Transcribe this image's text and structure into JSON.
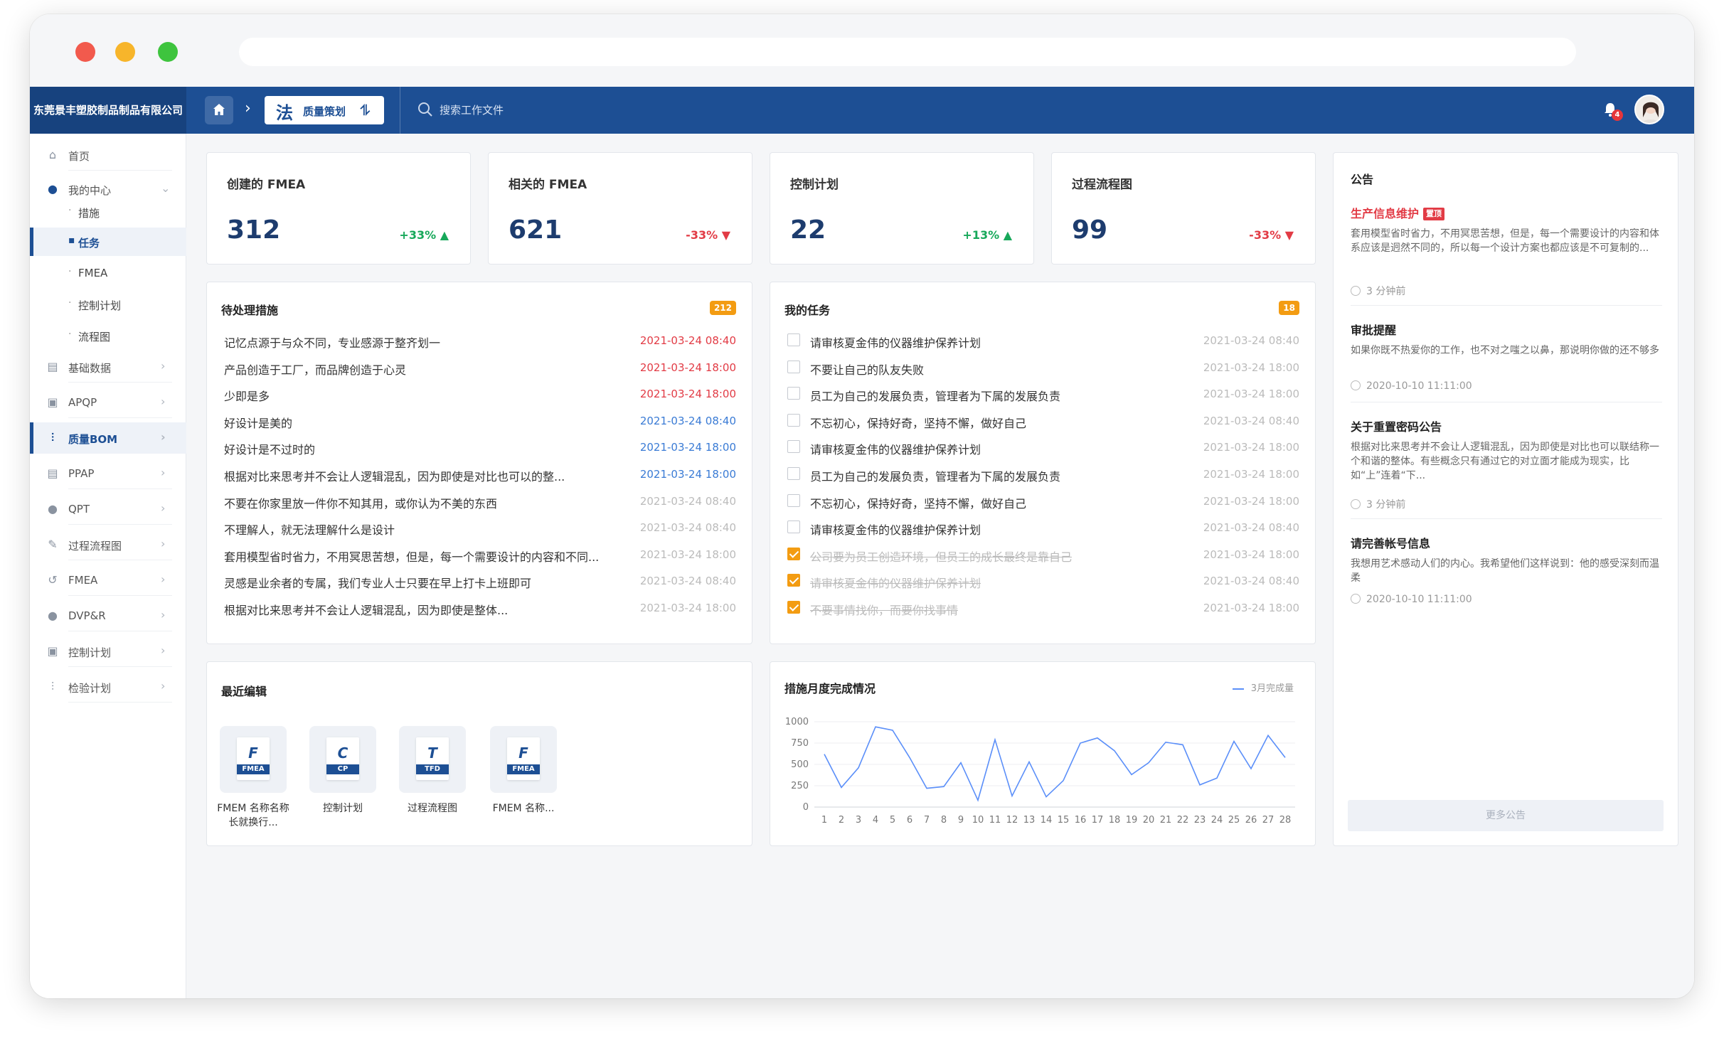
{
  "company": "东莞景丰塑胶制品制品有限公司",
  "breadcrumb": {
    "module_icon_text": "法",
    "module_label": "质量策划",
    "switch_glyph": "⥮"
  },
  "search": {
    "placeholder": "搜索工作文件"
  },
  "notifications": {
    "count": "4"
  },
  "sidebar": {
    "home": "首页",
    "my_center": "我的中心",
    "sub_items": [
      "措施",
      "任务",
      "FMEA",
      "控制计划",
      "流程图"
    ],
    "items": [
      "基础数据",
      "APQP",
      "质量BOM",
      "PPAP",
      "QPT",
      "过程流程图",
      "FMEA",
      "DVP&R",
      "控制计划",
      "检验计划"
    ]
  },
  "stats": [
    {
      "title": "创建的 FMEA",
      "value": "312",
      "change": "+33%",
      "trend": "up"
    },
    {
      "title": "相关的 FMEA",
      "value": "621",
      "change": "-33%",
      "trend": "down"
    },
    {
      "title": "控制计划",
      "value": "22",
      "change": "+13%",
      "trend": "up"
    },
    {
      "title": "过程流程图",
      "value": "99",
      "change": "-33%",
      "trend": "down"
    }
  ],
  "pending": {
    "title": "待处理措施",
    "count": "212",
    "rows": [
      {
        "text": "记忆点源于与众不同，专业感源于整齐划一",
        "date": "2021-03-24 08:40",
        "color": "red"
      },
      {
        "text": "产品创造于工厂，而品牌创造于心灵",
        "date": "2021-03-24 18:00",
        "color": "red"
      },
      {
        "text": "少即是多",
        "date": "2021-03-24 18:00",
        "color": "red"
      },
      {
        "text": "好设计是美的",
        "date": "2021-03-24 08:40",
        "color": "blue"
      },
      {
        "text": "好设计是不过时的",
        "date": "2021-03-24 18:00",
        "color": "blue"
      },
      {
        "text": "根据对比来思考并不会让人逻辑混乱，因为即使是对比也可以的整...",
        "date": "2021-03-24 18:00",
        "color": "blue"
      },
      {
        "text": "不要在你家里放一件你不知其用，或你认为不美的东西",
        "date": "2021-03-24 08:40",
        "color": "gray"
      },
      {
        "text": "不理解人，就无法理解什么是设计",
        "date": "2021-03-24 08:40",
        "color": "gray"
      },
      {
        "text": "套用模型省时省力，不用冥思苦想，但是，每一个需要设计的内容和不同...",
        "date": "2021-03-24 18:00",
        "color": "gray"
      },
      {
        "text": "灵感是业余者的专属，我们专业人士只要在早上打卡上班即可",
        "date": "2021-03-24 08:40",
        "color": "gray"
      },
      {
        "text": "根据对比来思考并不会让人逻辑混乱，因为即使是整体...",
        "date": "2021-03-24 18:00",
        "color": "gray"
      }
    ]
  },
  "tasks": {
    "title": "我的任务",
    "count": "18",
    "rows": [
      {
        "text": "请审核夏金伟的仪器维护保养计划",
        "date": "2021-03-24 08:40",
        "done": false
      },
      {
        "text": "不要让自己的队友失败",
        "date": "2021-03-24 18:00",
        "done": false
      },
      {
        "text": "员工为自己的发展负责，管理者为下属的发展负责",
        "date": "2021-03-24 18:00",
        "done": false
      },
      {
        "text": "不忘初心，保持好奇，坚持不懈，做好自己",
        "date": "2021-03-24 08:40",
        "done": false
      },
      {
        "text": "请审核夏金伟的仪器维护保养计划",
        "date": "2021-03-24 18:00",
        "done": false
      },
      {
        "text": "员工为自己的发展负责，管理者为下属的发展负责",
        "date": "2021-03-24 18:00",
        "done": false
      },
      {
        "text": "不忘初心，保持好奇，坚持不懈，做好自己",
        "date": "2021-03-24 18:00",
        "done": false
      },
      {
        "text": "请审核夏金伟的仪器维护保养计划",
        "date": "2021-03-24 08:40",
        "done": false
      },
      {
        "text": "公司要为员工创造环境，但员工的成长最终是靠自己",
        "date": "2021-03-24 18:00",
        "done": true
      },
      {
        "text": "请审核夏金伟的仪器维护保养计划",
        "date": "2021-03-24 08:40",
        "done": true
      },
      {
        "text": "不要事情找你，而要你找事情",
        "date": "2021-03-24 18:00",
        "done": true
      }
    ]
  },
  "recent": {
    "title": "最近编辑",
    "files": [
      {
        "letter": "F",
        "tag": "FMEA",
        "name": "FMEM 名称名称长就换行..."
      },
      {
        "letter": "C",
        "tag": "CP",
        "name": "控制计划"
      },
      {
        "letter": "T",
        "tag": "TFD",
        "name": "过程流程图"
      },
      {
        "letter": "F",
        "tag": "FMEA",
        "name": "FMEM 名称..."
      }
    ]
  },
  "chart_card": {
    "title": "措施月度完成情况"
  },
  "chart_data": {
    "type": "line",
    "title": "措施月度完成情况",
    "x": [
      1,
      2,
      3,
      4,
      5,
      6,
      7,
      8,
      9,
      10,
      11,
      12,
      13,
      14,
      15,
      16,
      17,
      18,
      19,
      20,
      21,
      22,
      23,
      24,
      25,
      26,
      27,
      28
    ],
    "series": [
      {
        "name": "3月完成量",
        "color": "#5b8ff9",
        "values": [
          620,
          230,
          460,
          940,
          900,
          580,
          220,
          240,
          520,
          80,
          790,
          130,
          530,
          120,
          310,
          750,
          810,
          660,
          380,
          520,
          760,
          730,
          260,
          340,
          770,
          450,
          840,
          580
        ]
      }
    ],
    "ylim": [
      0,
      1000
    ],
    "yticks": [
      0,
      250,
      500,
      750,
      1000
    ],
    "grid": true,
    "legend": "top-right"
  },
  "announcements": {
    "title": "公告",
    "items": [
      {
        "title": "生产信息维护",
        "tag": "置顶",
        "body": "套用模型省时省力，不用冥思苦想，但是，每一个需要设计的内容和体系应该是迥然不同的，所以每一个设计方案也都应该是不可复制的...",
        "time": "3 分钟前"
      },
      {
        "title": "审批提醒",
        "body": "如果你既不热爱你的工作，也不对之嗤之以鼻，那说明你做的还不够多",
        "time": "2020-10-10 11:11:00"
      },
      {
        "title": "关于重置密码公告",
        "body": "根据对比来思考并不会让人逻辑混乱，因为即使是对比也可以联结称一个和谐的整体。有些概念只有通过它的对立面才能成为现实，比如“上”连着“下...",
        "time": "3 分钟前"
      },
      {
        "title": "请完善帐号信息",
        "body": "我想用艺术感动人们的内心。我希望他们这样说到：他的感受深刻而温柔",
        "time": "2020-10-10 11:11:00"
      }
    ],
    "more": "更多公告"
  }
}
